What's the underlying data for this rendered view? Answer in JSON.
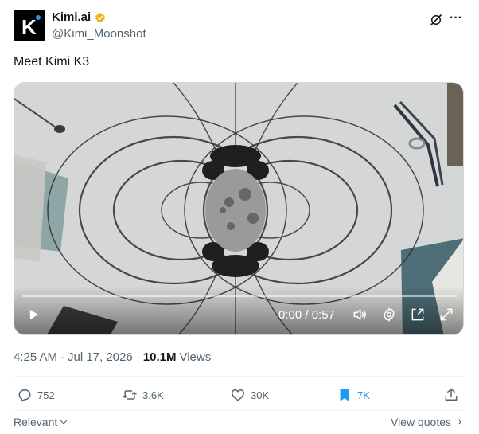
{
  "author": {
    "display_name": "Kimi.ai",
    "handle": "@Kimi_Moonshot",
    "avatar_letter": "K",
    "verified": "gold-verified-badge-icon"
  },
  "tweet": {
    "text": "Meet Kimi K3"
  },
  "video": {
    "time": "0:00 / 0:57",
    "progress_fraction": 0
  },
  "meta": {
    "time": "4:25 AM",
    "separator_1": "·",
    "date": "Jul 17, 2026",
    "separator_2": "·",
    "views_count": "10.1M",
    "views_label": "Views"
  },
  "actions": {
    "replies": "752",
    "reposts": "3.6K",
    "likes": "30K",
    "bookmarks": "7K"
  },
  "footer": {
    "sort_label": "Relevant",
    "view_quotes": "View quotes"
  },
  "colors": {
    "accent": "#1d9bf0",
    "text": "#0f1419",
    "secondary": "#536471",
    "verified": "#e8b71b"
  }
}
